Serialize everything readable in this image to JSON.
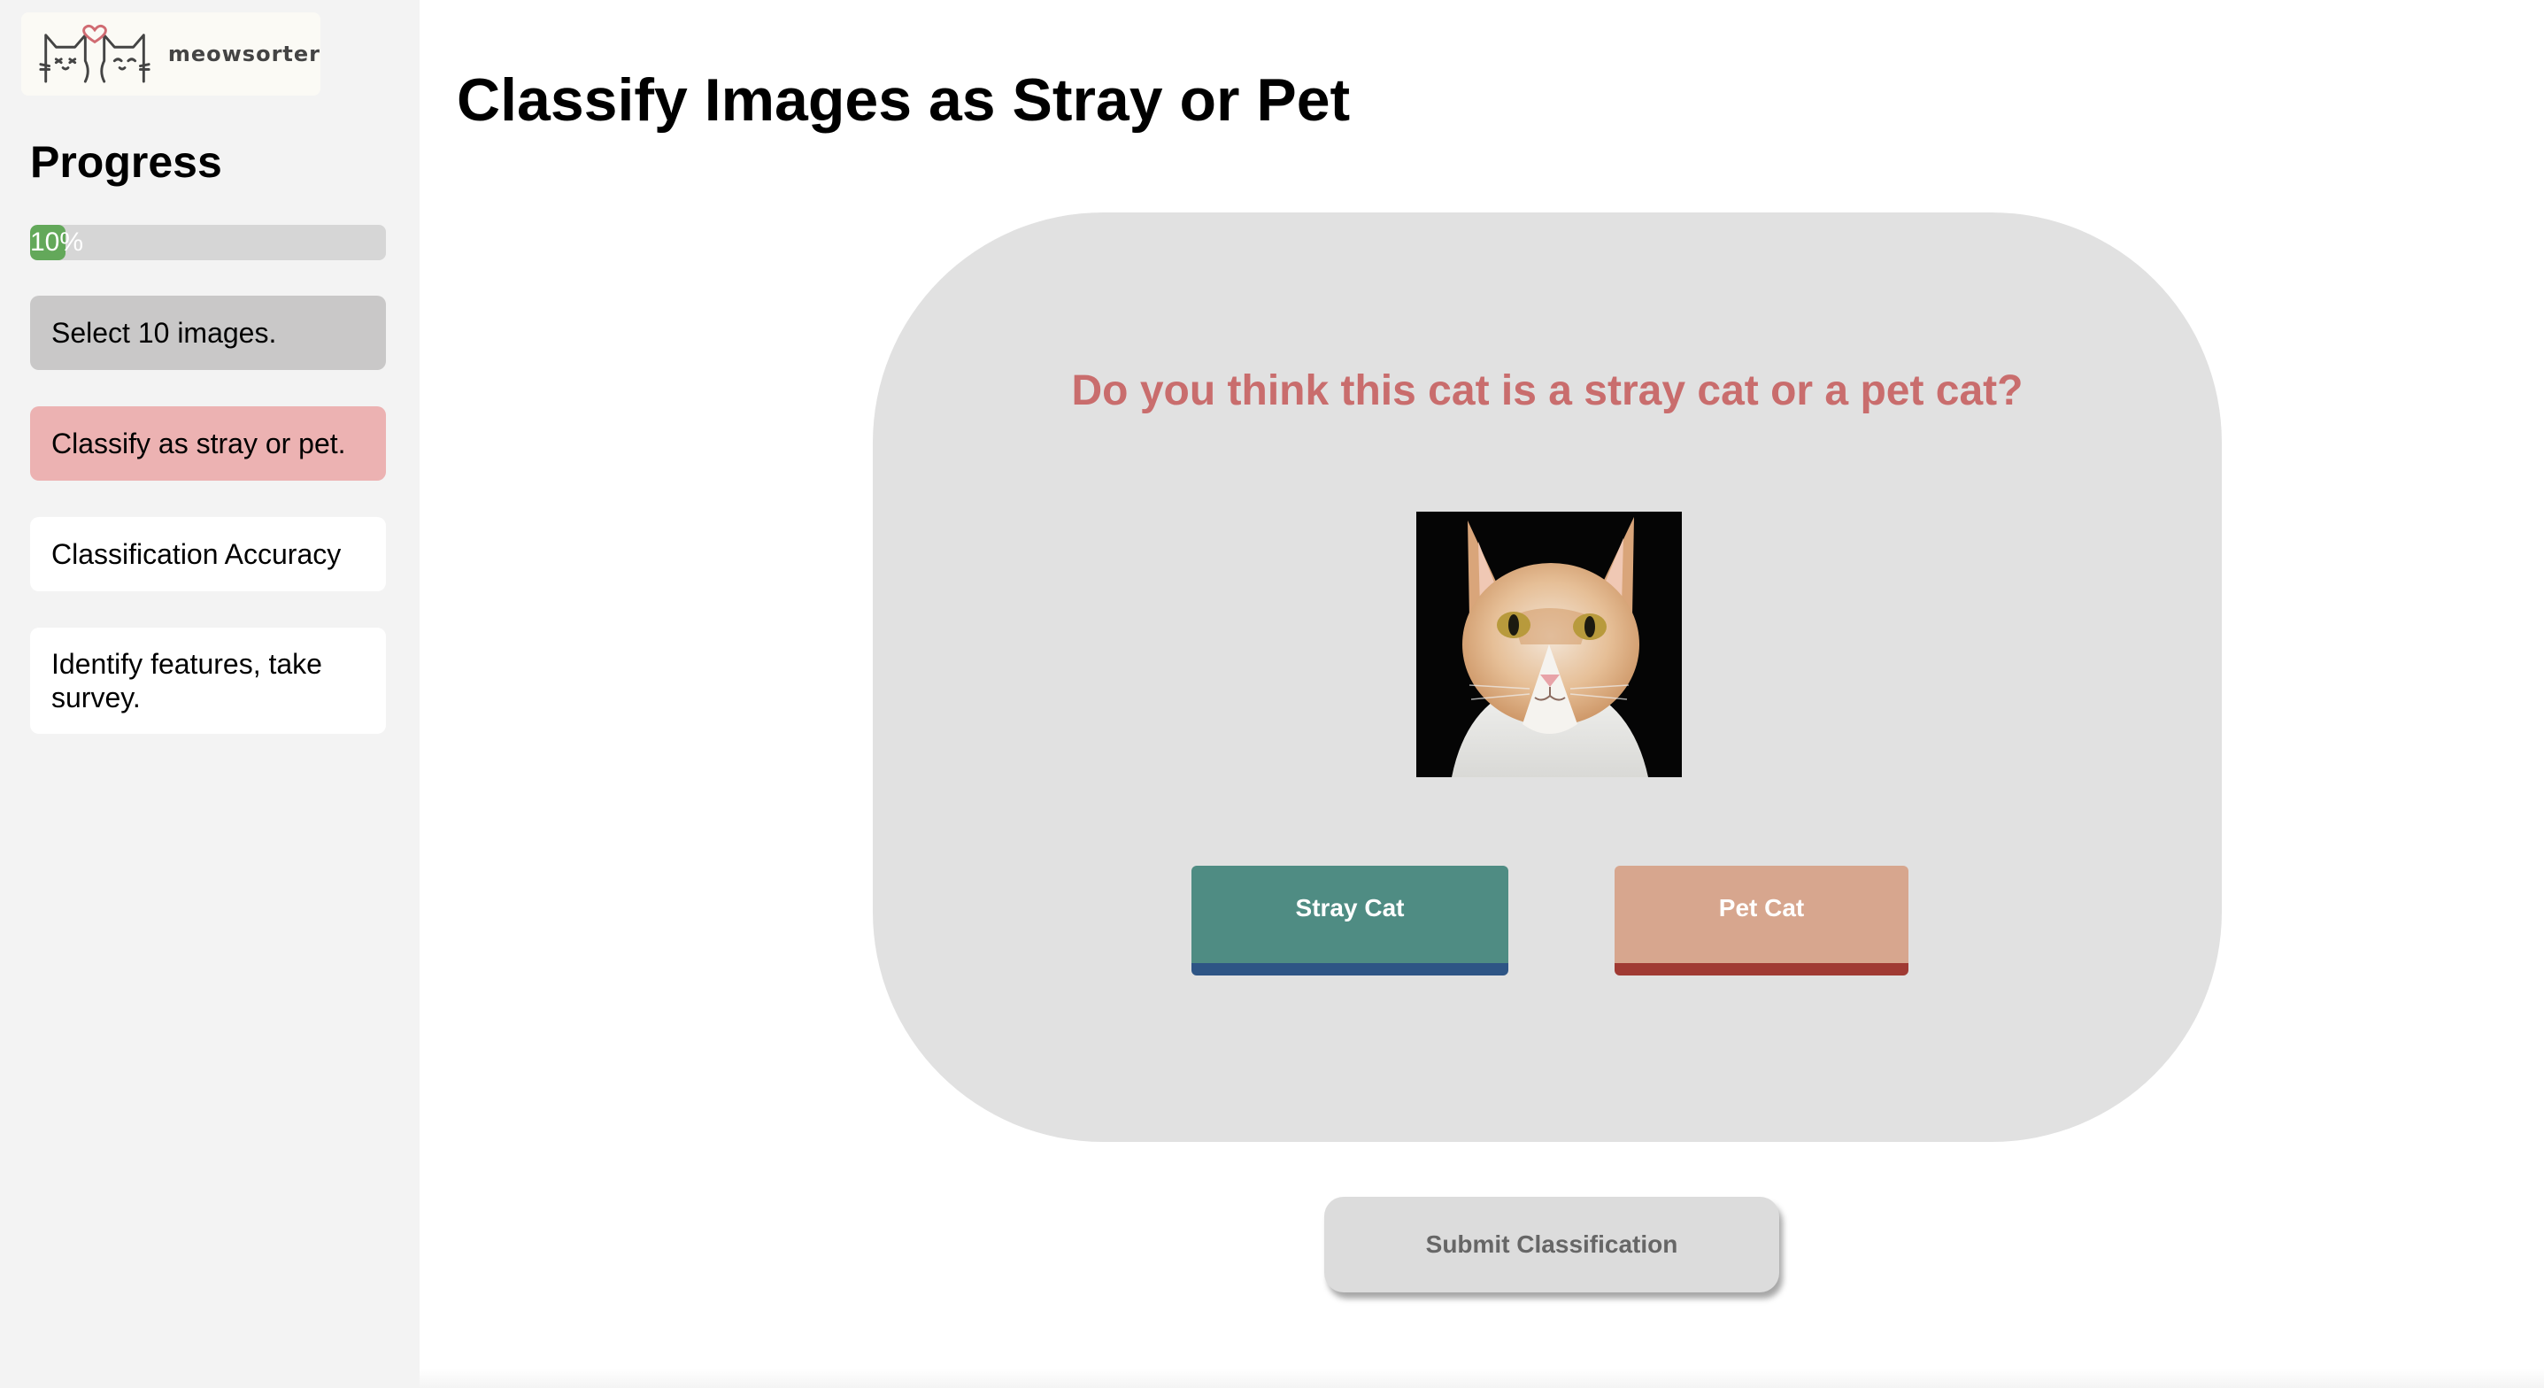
{
  "brand": {
    "name": "meowsorter"
  },
  "sidebar": {
    "progress_title": "Progress",
    "progress_value": 0.1,
    "progress_label": "10%",
    "steps": [
      {
        "label": "Select 10 images.",
        "status": "completed",
        "color": "#c9c8c8"
      },
      {
        "label": "Classify as stray or pet.",
        "status": "current",
        "color": "#ecb2b2"
      },
      {
        "label": "Classification Accuracy",
        "status": "pending",
        "color": "#ffffff"
      },
      {
        "label": "Identify features, take survey.",
        "status": "pending",
        "color": "#ffffff"
      }
    ]
  },
  "main": {
    "title": "Classify Images as Stray or Pet",
    "question": "Do you think this cat is a stray cat or a pet cat?",
    "image_icon": "cat-photo",
    "buttons": {
      "stray": "Stray Cat",
      "pet": "Pet Cat"
    },
    "submit_label": "Submit Classification"
  },
  "colors": {
    "progress_fill": "#63a85a",
    "question_text": "#c96d6d",
    "stray_button": "#4f8c83",
    "stray_button_edge": "#2e5585",
    "pet_button": "#d7a68e",
    "pet_button_edge": "#a03a33",
    "card_background": "#e1e1e1"
  }
}
